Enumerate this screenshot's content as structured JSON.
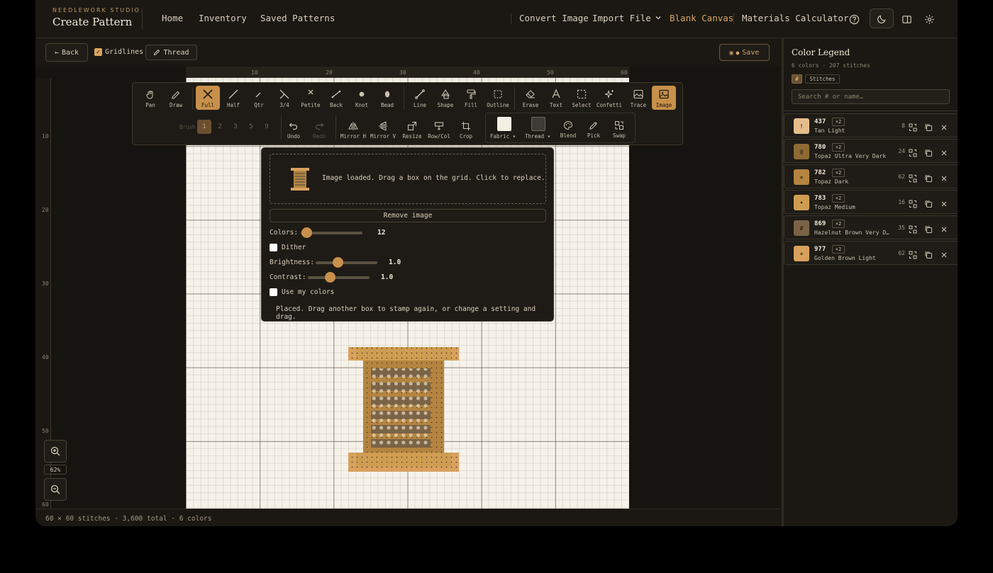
{
  "header": {
    "brand_sub": "NEEDLEWORK STUDIO",
    "brand_title": "Create Pattern",
    "nav": [
      "Home",
      "Inventory",
      "Saved Patterns"
    ],
    "actions": {
      "convert": "Convert Image",
      "import": "Import File",
      "blank": "Blank Canvas",
      "materials": "Materials Calculator"
    }
  },
  "subbar": {
    "back": "Back",
    "gridlines": "Gridlines",
    "thread": "Thread",
    "save": "Save"
  },
  "ruler": {
    "top": [
      "10",
      "20",
      "30",
      "40",
      "50",
      "60"
    ],
    "left": [
      "10",
      "20",
      "30",
      "40",
      "50",
      "60"
    ]
  },
  "tools": {
    "row1": [
      "Pan",
      "Draw",
      "Full",
      "Half",
      "Qtr",
      "3/4",
      "Petite",
      "Back",
      "Knot",
      "Bead",
      "Line",
      "Shape",
      "Fill",
      "Outline",
      "Erase",
      "Text",
      "Select",
      "Confetti",
      "Trace",
      "Image"
    ],
    "brush_label": "Brush",
    "brush_sizes": [
      "1",
      "2",
      "3",
      "5",
      "9"
    ],
    "row2": [
      "Undo",
      "Redo",
      "Mirror H",
      "Mirror V",
      "Resize",
      "Row/Col",
      "Crop"
    ],
    "fabric": "Fabric",
    "thread": "Thread",
    "row2b": [
      "Blend",
      "Pick",
      "Swap"
    ]
  },
  "image_panel": {
    "drop_text": "Image loaded. Drag a box on the grid. Click to replace.",
    "remove": "Remove image",
    "colors_label": "Colors:",
    "colors_value": "12",
    "dither": "Dither",
    "brightness_label": "Brightness:",
    "brightness_value": "1.0",
    "contrast_label": "Contrast:",
    "contrast_value": "1.0",
    "use_my_colors": "Use my colors",
    "status": "Placed. Drag another box to stamp again, or change a setting and drag."
  },
  "zoom": {
    "level": "62%"
  },
  "status": "60 × 60 stitches · 3,600 total · 6 colors",
  "legend": {
    "title": "Color Legend",
    "meta": "6 colors · 207 stitches",
    "tag_hash": "#",
    "tag_stitches": "Stitches",
    "search_placeholder": "Search  # or name…",
    "items": [
      {
        "symbol": "!",
        "code": "437",
        "mult": "×2",
        "name": "Tan Light",
        "count": "8",
        "color": "#e4bd8c"
      },
      {
        "symbol": "@",
        "code": "780",
        "mult": "×2",
        "name": "Topaz Ultra Very Dark",
        "count": "24",
        "color": "#8e6a35"
      },
      {
        "symbol": "×",
        "code": "782",
        "mult": "×2",
        "name": "Topaz Dark",
        "count": "62",
        "color": "#b48440"
      },
      {
        "symbol": "•",
        "code": "783",
        "mult": "×2",
        "name": "Topaz Medium",
        "count": "16",
        "color": "#cf9d52"
      },
      {
        "symbol": "#",
        "code": "869",
        "mult": "×2",
        "name": "Hazelnut Brown Very Dark",
        "count": "35",
        "color": "#7a6346"
      },
      {
        "symbol": "+",
        "code": "977",
        "mult": "×2",
        "name": "Golden Brown Light",
        "count": "62",
        "color": "#d8a15e"
      }
    ]
  }
}
